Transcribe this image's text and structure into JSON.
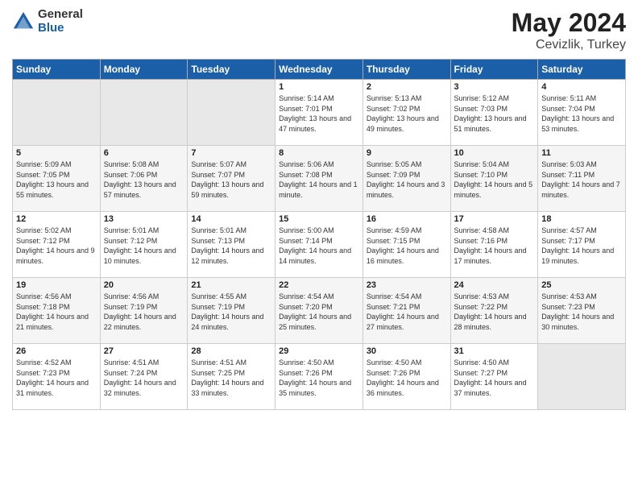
{
  "logo": {
    "general": "General",
    "blue": "Blue"
  },
  "title": {
    "month": "May 2024",
    "location": "Cevizlik, Turkey"
  },
  "days_of_week": [
    "Sunday",
    "Monday",
    "Tuesday",
    "Wednesday",
    "Thursday",
    "Friday",
    "Saturday"
  ],
  "weeks": [
    {
      "days": [
        {
          "number": "",
          "empty": true
        },
        {
          "number": "",
          "empty": true
        },
        {
          "number": "",
          "empty": true
        },
        {
          "number": "1",
          "sunrise": "5:14 AM",
          "sunset": "7:01 PM",
          "daylight": "13 hours and 47 minutes."
        },
        {
          "number": "2",
          "sunrise": "5:13 AM",
          "sunset": "7:02 PM",
          "daylight": "13 hours and 49 minutes."
        },
        {
          "number": "3",
          "sunrise": "5:12 AM",
          "sunset": "7:03 PM",
          "daylight": "13 hours and 51 minutes."
        },
        {
          "number": "4",
          "sunrise": "5:11 AM",
          "sunset": "7:04 PM",
          "daylight": "13 hours and 53 minutes."
        }
      ]
    },
    {
      "days": [
        {
          "number": "5",
          "sunrise": "5:09 AM",
          "sunset": "7:05 PM",
          "daylight": "13 hours and 55 minutes."
        },
        {
          "number": "6",
          "sunrise": "5:08 AM",
          "sunset": "7:06 PM",
          "daylight": "13 hours and 57 minutes."
        },
        {
          "number": "7",
          "sunrise": "5:07 AM",
          "sunset": "7:07 PM",
          "daylight": "13 hours and 59 minutes."
        },
        {
          "number": "8",
          "sunrise": "5:06 AM",
          "sunset": "7:08 PM",
          "daylight": "14 hours and 1 minute."
        },
        {
          "number": "9",
          "sunrise": "5:05 AM",
          "sunset": "7:09 PM",
          "daylight": "14 hours and 3 minutes."
        },
        {
          "number": "10",
          "sunrise": "5:04 AM",
          "sunset": "7:10 PM",
          "daylight": "14 hours and 5 minutes."
        },
        {
          "number": "11",
          "sunrise": "5:03 AM",
          "sunset": "7:11 PM",
          "daylight": "14 hours and 7 minutes."
        }
      ]
    },
    {
      "days": [
        {
          "number": "12",
          "sunrise": "5:02 AM",
          "sunset": "7:12 PM",
          "daylight": "14 hours and 9 minutes."
        },
        {
          "number": "13",
          "sunrise": "5:01 AM",
          "sunset": "7:12 PM",
          "daylight": "14 hours and 10 minutes."
        },
        {
          "number": "14",
          "sunrise": "5:01 AM",
          "sunset": "7:13 PM",
          "daylight": "14 hours and 12 minutes."
        },
        {
          "number": "15",
          "sunrise": "5:00 AM",
          "sunset": "7:14 PM",
          "daylight": "14 hours and 14 minutes."
        },
        {
          "number": "16",
          "sunrise": "4:59 AM",
          "sunset": "7:15 PM",
          "daylight": "14 hours and 16 minutes."
        },
        {
          "number": "17",
          "sunrise": "4:58 AM",
          "sunset": "7:16 PM",
          "daylight": "14 hours and 17 minutes."
        },
        {
          "number": "18",
          "sunrise": "4:57 AM",
          "sunset": "7:17 PM",
          "daylight": "14 hours and 19 minutes."
        }
      ]
    },
    {
      "days": [
        {
          "number": "19",
          "sunrise": "4:56 AM",
          "sunset": "7:18 PM",
          "daylight": "14 hours and 21 minutes."
        },
        {
          "number": "20",
          "sunrise": "4:56 AM",
          "sunset": "7:19 PM",
          "daylight": "14 hours and 22 minutes."
        },
        {
          "number": "21",
          "sunrise": "4:55 AM",
          "sunset": "7:19 PM",
          "daylight": "14 hours and 24 minutes."
        },
        {
          "number": "22",
          "sunrise": "4:54 AM",
          "sunset": "7:20 PM",
          "daylight": "14 hours and 25 minutes."
        },
        {
          "number": "23",
          "sunrise": "4:54 AM",
          "sunset": "7:21 PM",
          "daylight": "14 hours and 27 minutes."
        },
        {
          "number": "24",
          "sunrise": "4:53 AM",
          "sunset": "7:22 PM",
          "daylight": "14 hours and 28 minutes."
        },
        {
          "number": "25",
          "sunrise": "4:53 AM",
          "sunset": "7:23 PM",
          "daylight": "14 hours and 30 minutes."
        }
      ]
    },
    {
      "days": [
        {
          "number": "26",
          "sunrise": "4:52 AM",
          "sunset": "7:23 PM",
          "daylight": "14 hours and 31 minutes."
        },
        {
          "number": "27",
          "sunrise": "4:51 AM",
          "sunset": "7:24 PM",
          "daylight": "14 hours and 32 minutes."
        },
        {
          "number": "28",
          "sunrise": "4:51 AM",
          "sunset": "7:25 PM",
          "daylight": "14 hours and 33 minutes."
        },
        {
          "number": "29",
          "sunrise": "4:50 AM",
          "sunset": "7:26 PM",
          "daylight": "14 hours and 35 minutes."
        },
        {
          "number": "30",
          "sunrise": "4:50 AM",
          "sunset": "7:26 PM",
          "daylight": "14 hours and 36 minutes."
        },
        {
          "number": "31",
          "sunrise": "4:50 AM",
          "sunset": "7:27 PM",
          "daylight": "14 hours and 37 minutes."
        },
        {
          "number": "",
          "empty": true
        }
      ]
    }
  ]
}
